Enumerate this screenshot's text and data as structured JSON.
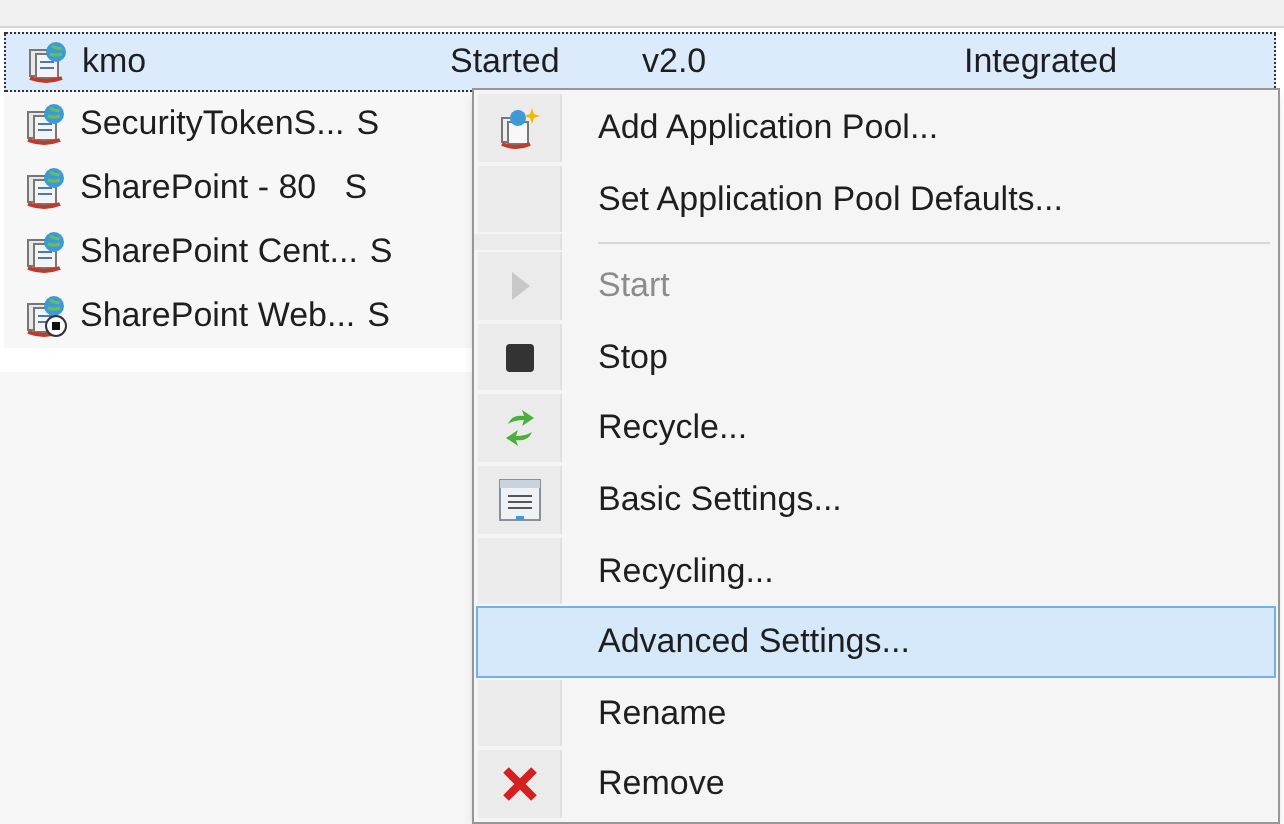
{
  "pools": [
    {
      "name": "kmo",
      "selected": true,
      "stopped": false,
      "cells": [
        "Started",
        "v2.0",
        "Integrated"
      ]
    },
    {
      "name": "SecurityTokenS...",
      "selected": false,
      "stopped": false,
      "cells": [
        "S"
      ]
    },
    {
      "name": "SharePoint - 80",
      "selected": false,
      "stopped": false,
      "cells": [
        "S"
      ]
    },
    {
      "name": "SharePoint Cent...",
      "selected": false,
      "stopped": false,
      "cells": [
        "S"
      ]
    },
    {
      "name": "SharePoint Web...",
      "selected": false,
      "stopped": true,
      "cells": [
        "S"
      ]
    }
  ],
  "context_menu": [
    {
      "kind": "item",
      "label": "Add Application Pool...",
      "disabled": false,
      "selected": false
    },
    {
      "kind": "item",
      "label": "Set Application Pool Defaults...",
      "disabled": false,
      "selected": false
    },
    {
      "kind": "separator"
    },
    {
      "kind": "item",
      "label": "Start",
      "disabled": true,
      "selected": false
    },
    {
      "kind": "item",
      "label": "Stop",
      "disabled": false,
      "selected": false
    },
    {
      "kind": "item",
      "label": "Recycle...",
      "disabled": false,
      "selected": false
    },
    {
      "kind": "item",
      "label": "Basic Settings...",
      "disabled": false,
      "selected": false
    },
    {
      "kind": "item",
      "label": "Recycling...",
      "disabled": false,
      "selected": false
    },
    {
      "kind": "item",
      "label": "Advanced Settings...",
      "disabled": false,
      "selected": true
    },
    {
      "kind": "item",
      "label": "Rename",
      "disabled": false,
      "selected": false
    },
    {
      "kind": "item",
      "label": "Remove",
      "disabled": false,
      "selected": false
    }
  ]
}
